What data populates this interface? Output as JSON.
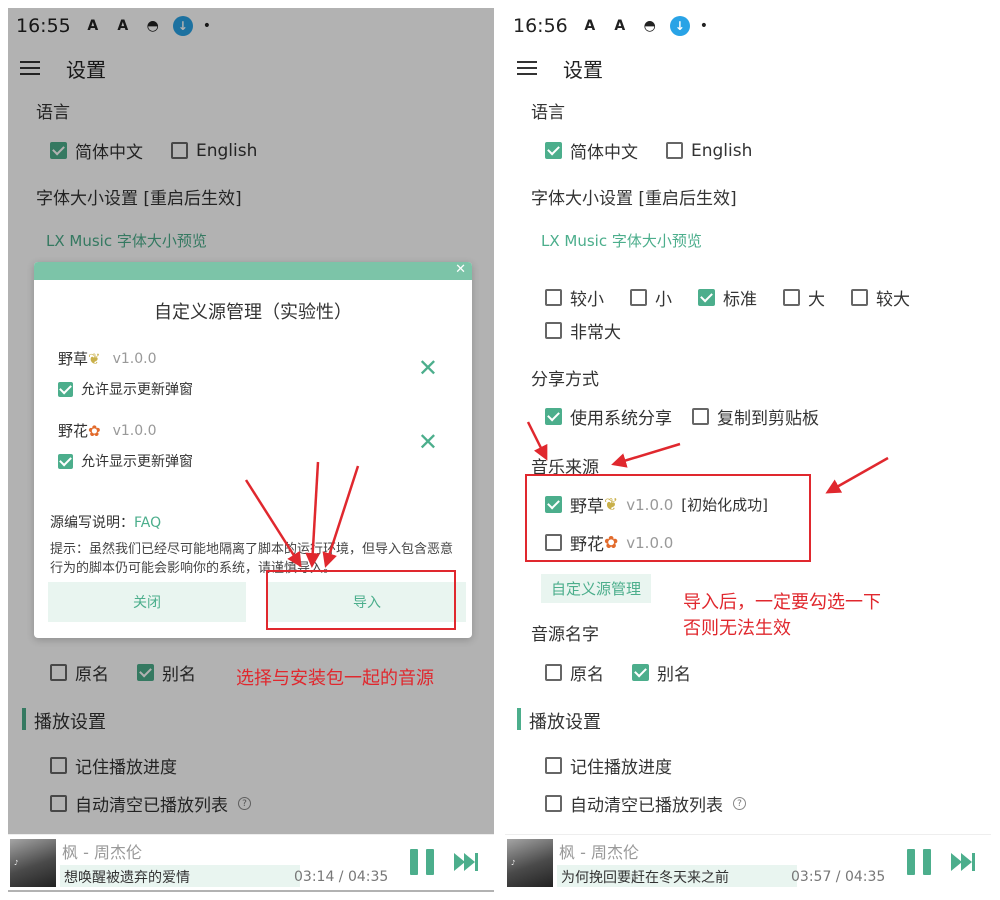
{
  "left": {
    "status": {
      "time": "16:55"
    },
    "appbar": {
      "title": "设置"
    },
    "language": {
      "section": "语言",
      "zh": "简体中文",
      "en": "English"
    },
    "font": {
      "section": "字体大小设置 [重启后生效]",
      "preview": "LX Music 字体大小预览"
    },
    "dialog": {
      "title": "自定义源管理（实验性）",
      "sources": [
        {
          "name": "野草",
          "version": "v1.0.0",
          "allow": "允许显示更新弹窗"
        },
        {
          "name": "野花",
          "version": "v1.0.0",
          "allow": "允许显示更新弹窗"
        }
      ],
      "faq_label": "源编写说明：",
      "faq_link": "FAQ",
      "tip": "提示：虽然我们已经尽可能地隔离了脚本的运行环境，但导入包含恶意行为的脚本仍可能会影响你的系统，请谨慎导入。",
      "close": "关闭",
      "import": "导入"
    },
    "source_name": {
      "original": "原名",
      "alias": "别名"
    },
    "playback": {
      "section": "播放设置",
      "remember": "记住播放进度",
      "auto_clear": "自动清空已播放列表"
    },
    "player": {
      "song": "枫 - 周杰伦",
      "lyric": "想唤醒被遗弃的爱情",
      "time": "03:14 / 04:35"
    },
    "annotation": "选择与安装包一起的音源"
  },
  "right": {
    "status": {
      "time": "16:56"
    },
    "appbar": {
      "title": "设置"
    },
    "language": {
      "section": "语言",
      "zh": "简体中文",
      "en": "English"
    },
    "font": {
      "section": "字体大小设置 [重启后生效]",
      "preview": "LX Music 字体大小预览",
      "sizes": [
        "较小",
        "小",
        "标准",
        "大",
        "较大",
        "非常大"
      ],
      "selected": "标准"
    },
    "share": {
      "section": "分享方式",
      "system": "使用系统分享",
      "clipboard": "复制到剪贴板"
    },
    "music_source": {
      "section": "音乐来源",
      "items": [
        {
          "name": "野草",
          "version": "v1.0.0",
          "status": "[初始化成功]",
          "checked": true
        },
        {
          "name": "野花",
          "version": "v1.0.0",
          "checked": false
        }
      ],
      "manage": "自定义源管理"
    },
    "source_name": {
      "section": "音源名字",
      "original": "原名",
      "alias": "别名"
    },
    "playback": {
      "section": "播放设置",
      "remember": "记住播放进度",
      "auto_clear": "自动清空已播放列表"
    },
    "player": {
      "song": "枫 - 周杰伦",
      "lyric": "为何挽回要赶在冬天来之前",
      "time": "03:57 / 04:35"
    },
    "annotation": [
      "导入后，一定要勾选一下",
      "否则无法生效"
    ]
  },
  "colors": {
    "accent": "#4cae8c",
    "annotation": "#e0282e",
    "dialog_header": "#7cc4a8"
  },
  "icons": [
    "menu-icon",
    "android-icon",
    "download-icon",
    "close-icon",
    "help-icon",
    "pause-icon",
    "next-icon"
  ]
}
